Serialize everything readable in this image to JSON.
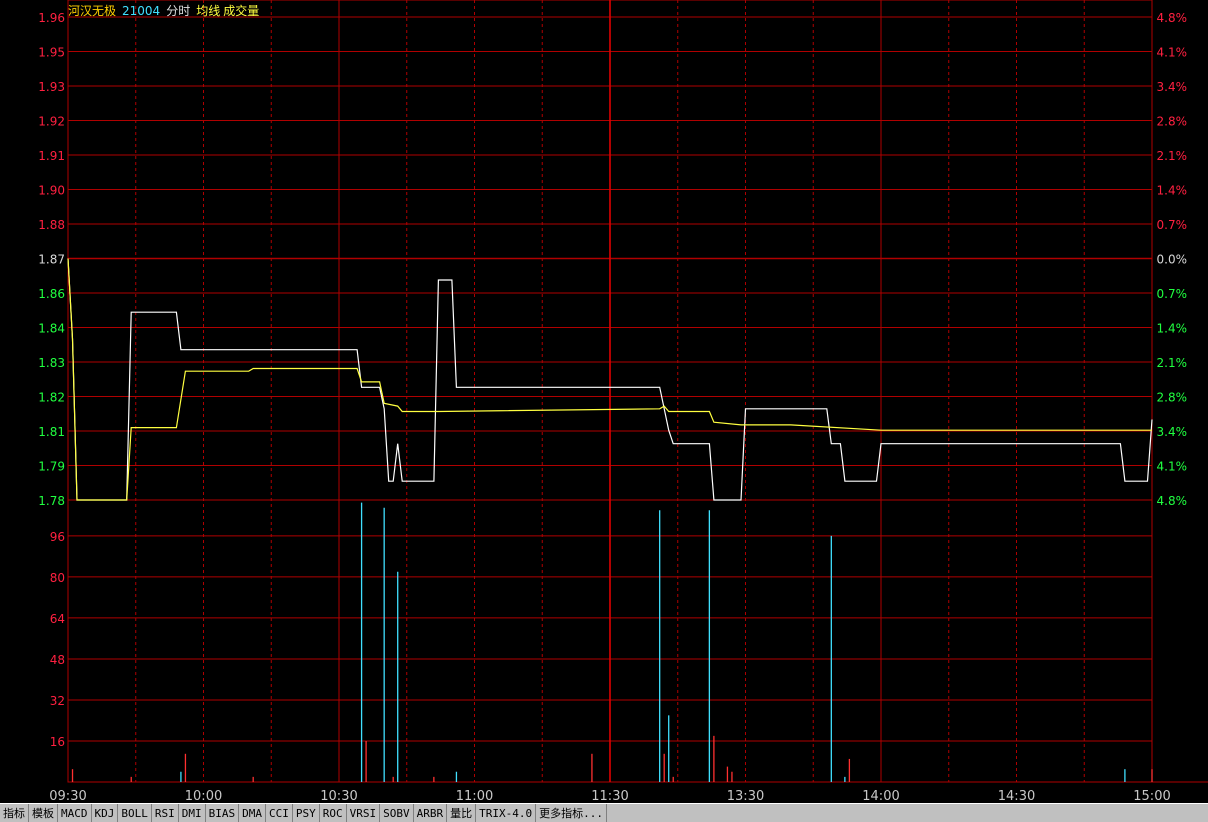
{
  "header": {
    "stock_name": "河汉无极",
    "stock_code": "21004",
    "mode": "分时",
    "avg_label": "均线",
    "volume_label": "成交量"
  },
  "colors": {
    "background": "#000000",
    "grid": "#b00000",
    "up": "#ff2040",
    "down": "#20ff40",
    "neutral": "#d8d8d8",
    "price_line": "#ffffff",
    "avg_line": "#ffff40",
    "vol_up": "#ff3030",
    "vol_down": "#40e0ff",
    "title_name": "#ffd000",
    "title_code": "#c0c0c0"
  },
  "tabs": [
    "指标",
    "模板",
    "MACD",
    "KDJ",
    "BOLL",
    "RSI",
    "DMI",
    "BIAS",
    "DMA",
    "CCI",
    "PSY",
    "ROC",
    "VRSI",
    "SOBV",
    "ARBR",
    "量比",
    "TRIX-4.0",
    "更多指标..."
  ],
  "chart_data": {
    "type": "line",
    "prev_close": 1.87,
    "price_labels": [
      "1.96",
      "1.95",
      "1.93",
      "1.92",
      "1.91",
      "1.90",
      "1.88",
      "1.87",
      "1.86",
      "1.84",
      "1.83",
      "1.82",
      "1.81",
      "1.79",
      "1.78"
    ],
    "pct_labels": [
      "4.8%",
      "4.1%",
      "3.4%",
      "2.8%",
      "2.1%",
      "1.4%",
      "0.7%",
      "0.0%",
      "0.7%",
      "1.4%",
      "2.1%",
      "2.8%",
      "3.4%",
      "4.1%",
      "4.8%"
    ],
    "price_range": [
      1.78,
      1.96
    ],
    "volume_labels": [
      "96",
      "80",
      "64",
      "48",
      "32",
      "16"
    ],
    "volume_range": [
      0,
      110
    ],
    "x_ticks": [
      "09:30",
      "10:00",
      "10:30",
      "11:00",
      "11:30",
      "13:30",
      "14:00",
      "14:30",
      "15:00"
    ],
    "total_minutes": 240,
    "series": [
      {
        "key": "price",
        "points": [
          [
            0,
            1.87
          ],
          [
            1,
            1.84
          ],
          [
            2,
            1.78
          ],
          [
            13,
            1.78
          ],
          [
            14,
            1.85
          ],
          [
            24,
            1.85
          ],
          [
            25,
            1.836
          ],
          [
            64,
            1.836
          ],
          [
            65,
            1.822
          ],
          [
            69,
            1.822
          ],
          [
            70,
            1.814
          ],
          [
            71,
            1.787
          ],
          [
            72,
            1.787
          ],
          [
            73,
            1.801
          ],
          [
            74,
            1.787
          ],
          [
            81,
            1.787
          ],
          [
            82,
            1.862
          ],
          [
            85,
            1.862
          ],
          [
            86,
            1.822
          ],
          [
            131,
            1.822
          ],
          [
            133,
            1.806
          ],
          [
            134,
            1.801
          ],
          [
            142,
            1.801
          ],
          [
            143,
            1.78
          ],
          [
            149,
            1.78
          ],
          [
            150,
            1.814
          ],
          [
            168,
            1.814
          ],
          [
            169,
            1.801
          ],
          [
            171,
            1.801
          ],
          [
            172,
            1.787
          ],
          [
            179,
            1.787
          ],
          [
            180,
            1.801
          ],
          [
            233,
            1.801
          ],
          [
            234,
            1.787
          ],
          [
            239,
            1.787
          ],
          [
            240,
            1.81
          ]
        ]
      },
      {
        "key": "average",
        "points": [
          [
            0,
            1.87
          ],
          [
            1,
            1.84
          ],
          [
            2,
            1.78
          ],
          [
            13,
            1.78
          ],
          [
            14,
            1.807
          ],
          [
            24,
            1.807
          ],
          [
            26,
            1.828
          ],
          [
            40,
            1.828
          ],
          [
            41,
            1.829
          ],
          [
            64,
            1.829
          ],
          [
            65,
            1.824
          ],
          [
            69,
            1.824
          ],
          [
            70,
            1.816
          ],
          [
            73,
            1.815
          ],
          [
            74,
            1.813
          ],
          [
            80,
            1.813
          ],
          [
            82,
            1.813
          ],
          [
            131,
            1.814
          ],
          [
            132,
            1.815
          ],
          [
            133,
            1.813
          ],
          [
            142,
            1.813
          ],
          [
            143,
            1.809
          ],
          [
            149,
            1.808
          ],
          [
            160,
            1.808
          ],
          [
            180,
            1.806
          ],
          [
            240,
            1.806
          ]
        ]
      }
    ],
    "volume": [
      {
        "t": 1,
        "v": 5,
        "dir": "up"
      },
      {
        "t": 14,
        "v": 2,
        "dir": "up"
      },
      {
        "t": 25,
        "v": 4,
        "dir": "down"
      },
      {
        "t": 26,
        "v": 11,
        "dir": "up"
      },
      {
        "t": 41,
        "v": 2,
        "dir": "up"
      },
      {
        "t": 65,
        "v": 109,
        "dir": "down"
      },
      {
        "t": 66,
        "v": 16,
        "dir": "up"
      },
      {
        "t": 70,
        "v": 107,
        "dir": "down"
      },
      {
        "t": 72,
        "v": 2,
        "dir": "up"
      },
      {
        "t": 73,
        "v": 82,
        "dir": "down"
      },
      {
        "t": 81,
        "v": 2,
        "dir": "up"
      },
      {
        "t": 86,
        "v": 4,
        "dir": "down"
      },
      {
        "t": 116,
        "v": 11,
        "dir": "up"
      },
      {
        "t": 131,
        "v": 106,
        "dir": "down"
      },
      {
        "t": 132,
        "v": 11,
        "dir": "up"
      },
      {
        "t": 133,
        "v": 26,
        "dir": "down"
      },
      {
        "t": 134,
        "v": 2,
        "dir": "up"
      },
      {
        "t": 142,
        "v": 106,
        "dir": "down"
      },
      {
        "t": 143,
        "v": 18,
        "dir": "up"
      },
      {
        "t": 146,
        "v": 6,
        "dir": "up"
      },
      {
        "t": 147,
        "v": 4,
        "dir": "up"
      },
      {
        "t": 169,
        "v": 96,
        "dir": "down"
      },
      {
        "t": 172,
        "v": 2,
        "dir": "down"
      },
      {
        "t": 173,
        "v": 9,
        "dir": "up"
      },
      {
        "t": 234,
        "v": 5,
        "dir": "down"
      },
      {
        "t": 240,
        "v": 5,
        "dir": "up"
      }
    ]
  }
}
